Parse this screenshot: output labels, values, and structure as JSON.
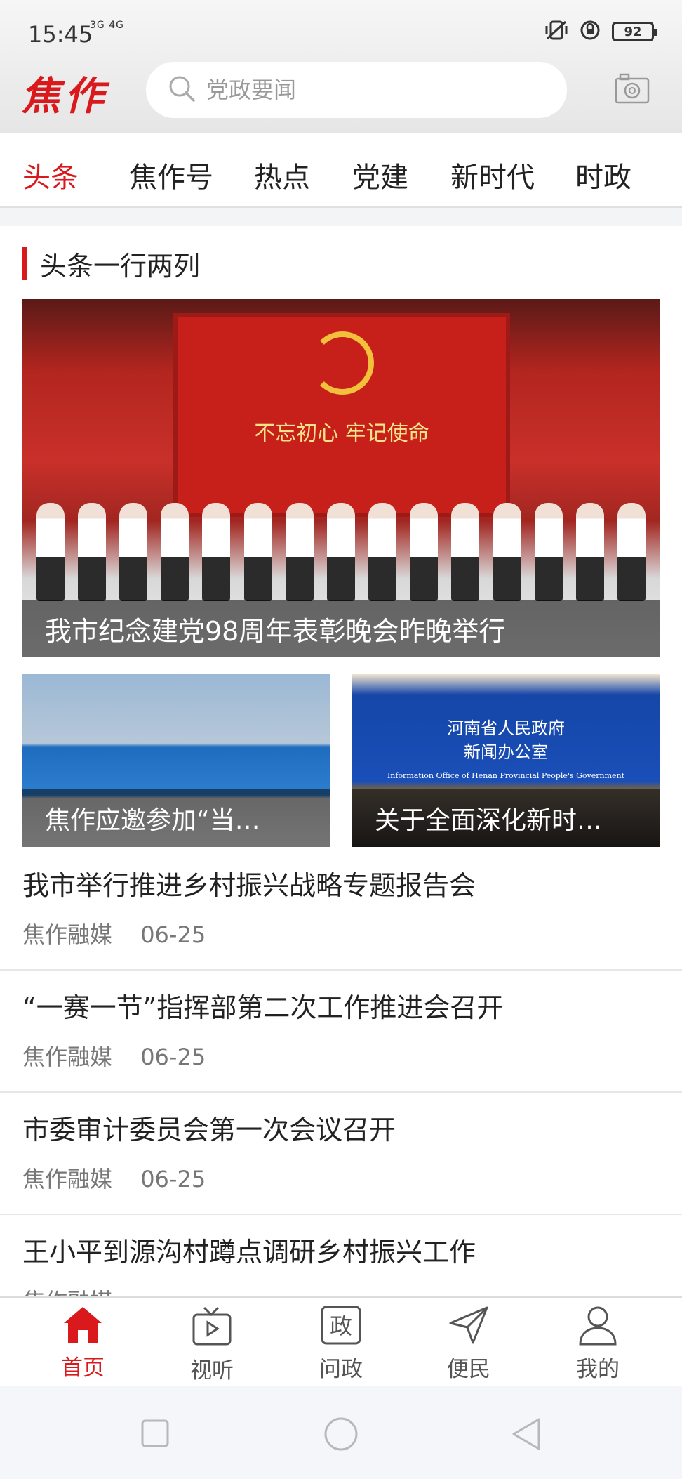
{
  "status_bar": {
    "time": "15:45",
    "network": "3G 4G",
    "battery": "92"
  },
  "header": {
    "logo": "焦作",
    "search_placeholder": "党政要闻"
  },
  "tabs": [
    "头条",
    "焦作号",
    "热点",
    "党建",
    "新时代",
    "时政"
  ],
  "section": {
    "title": "头条一行两列"
  },
  "hero": {
    "banner_slogan": "不忘初心  牢记使命",
    "caption": "我市纪念建党98周年表彰晚会昨晚举行"
  },
  "thumbs": [
    {
      "caption": "焦作应邀参加“当…"
    },
    {
      "caption": "关于全面深化新时…"
    }
  ],
  "thumb2_label": {
    "line1": "河南省人民政府",
    "line2": "新闻办公室",
    "line3": "Information Office of Henan Provincial People's Government"
  },
  "news": [
    {
      "title": "我市举行推进乡村振兴战略专题报告会",
      "source": "焦作融媒",
      "date": "06-25"
    },
    {
      "title": "“一赛一节”指挥部第二次工作推进会召开",
      "source": "焦作融媒",
      "date": "06-25"
    },
    {
      "title": "市委审计委员会第一次会议召开",
      "source": "焦作融媒",
      "date": "06-25"
    },
    {
      "title": "王小平到源沟村蹲点调研乡村振兴工作",
      "source": "焦作融媒",
      "date": ""
    }
  ],
  "bottom_nav": [
    "首页",
    "视听",
    "问政",
    "便民",
    "我的"
  ],
  "colors": {
    "accent": "#d9191c",
    "text": "#222222",
    "muted": "#777777"
  }
}
